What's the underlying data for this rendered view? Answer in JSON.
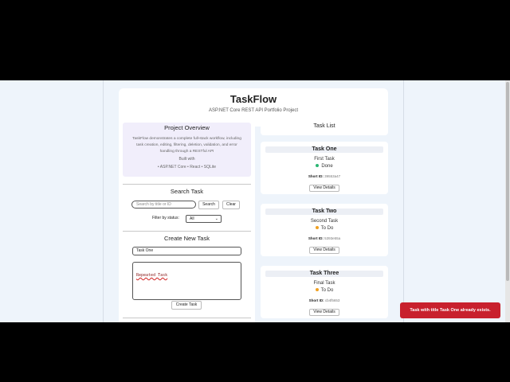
{
  "app": {
    "title": "TaskFlow",
    "subtitle": "ASP.NET Core REST API Portfolio Project"
  },
  "overview": {
    "heading": "Project Overview",
    "description": "TaskFlow demonstrates a complete full-stack workflow, including task creation, editing, filtering, deletion, validation, and error handling through a RESTful API",
    "built_with_label": "Built with",
    "stack": "• ASP.NET Core • React • SQLite"
  },
  "search": {
    "heading": "Search Task",
    "placeholder": "Search by title or ID",
    "search_label": "Search",
    "clear_label": "Clear",
    "filter_label": "Filter by status:",
    "filter_value": "All"
  },
  "create": {
    "heading": "Create New Task",
    "title_value": "Task One",
    "description_value": "Repeated Task",
    "button_label": "Create Task"
  },
  "task_list": {
    "heading": "Task List",
    "tasks": [
      {
        "name": "Task One",
        "title": "First Task",
        "status": "Done",
        "short_id_label": "Short ID:",
        "short_id": "39553a47",
        "view_label": "View Details"
      },
      {
        "name": "Task Two",
        "title": "Second Task",
        "status": "To Do",
        "short_id_label": "Short ID:",
        "short_id": "5393e55a",
        "view_label": "View Details"
      },
      {
        "name": "Task Three",
        "title": "Final Task",
        "status": "To Do",
        "short_id_label": "Short ID:",
        "short_id": "cb4f5653",
        "view_label": "View Details"
      }
    ]
  },
  "toast": {
    "message": "Task with title Task One already exists."
  },
  "colors": {
    "done_dot": "#2bb673",
    "todo_dot": "#f0a020",
    "toast_bg": "#c8212d",
    "overview_bg": "#f1eefb",
    "page_bg": "#eef4fb"
  }
}
